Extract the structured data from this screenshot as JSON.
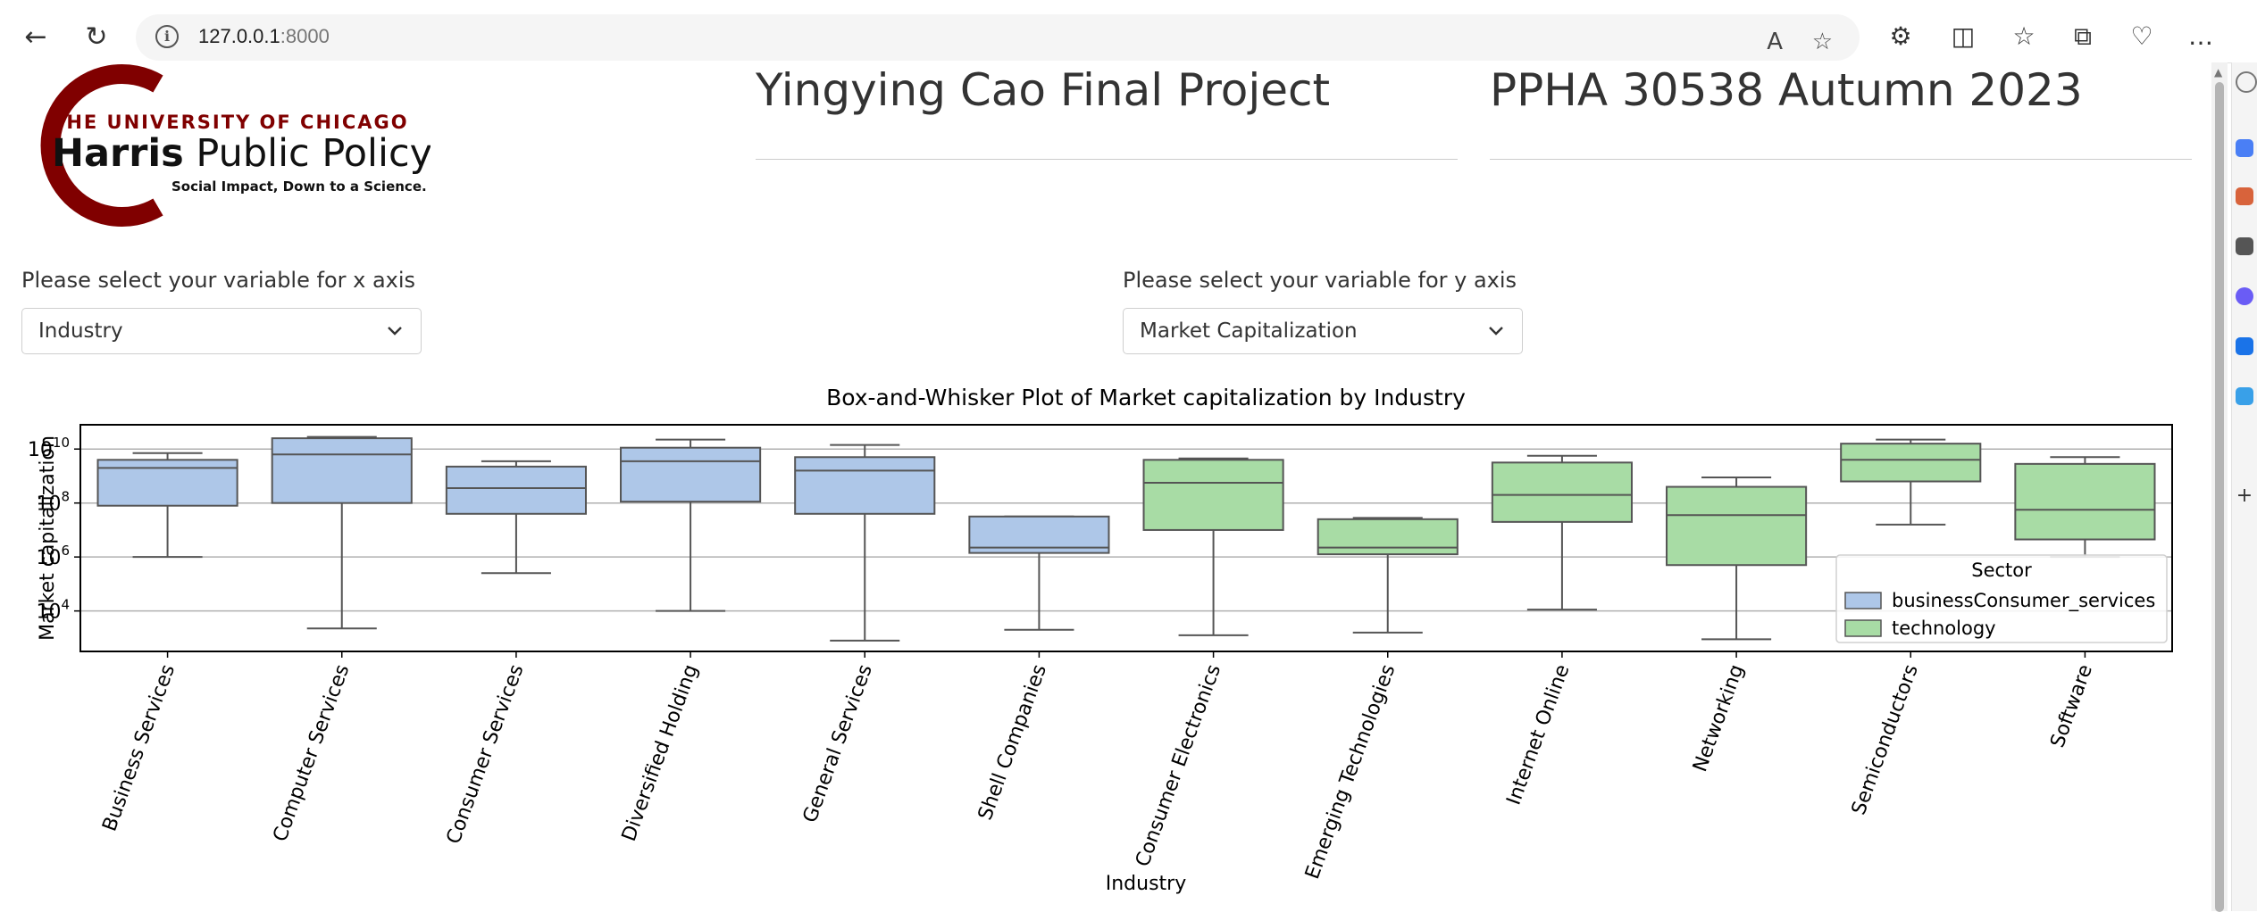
{
  "browser": {
    "url_host": "127.0.0.1",
    "url_port": ":8000"
  },
  "header": {
    "logo": {
      "line1": "THE UNIVERSITY OF CHICAGO",
      "line2_bold": "Harris",
      "line2_rest": " Public Policy",
      "tagline": "Social Impact, Down to a Science."
    },
    "title": "Yingying Cao Final Project",
    "course": "PPHA 30538 Autumn 2023"
  },
  "controls": {
    "x_label": "Please select your variable for x axis",
    "x_selected": "Industry",
    "y_label": "Please select your variable for y axis",
    "y_selected": "Market Capitalization"
  },
  "colors": {
    "business": "#aec7e8",
    "technology": "#a8dca5",
    "box_line": "#555555"
  },
  "chart_data": {
    "type": "box",
    "title": "Box-and-Whisker Plot of Market capitalization by Industry",
    "xlabel": "Industry",
    "ylabel": "Market capitalization",
    "yscale": "log",
    "ytick_exponents": [
      4,
      6,
      8,
      10
    ],
    "ylim_log10": [
      2.5,
      10.9
    ],
    "grid": "horizontal",
    "legend": {
      "title": "Sector",
      "placement": "right",
      "entries": [
        "businessConsumer_services",
        "technology"
      ]
    },
    "categories": [
      "Business Services",
      "Computer Services",
      "Consumer Services",
      "Diversified Holding",
      "General Services",
      "Shell Companies",
      "Consumer Electronics",
      "Emerging Technologies",
      "Internet Online",
      "Networking",
      "Semiconductors",
      "Software"
    ],
    "boxes": [
      {
        "category": "Business Services",
        "sector": "businessConsumer_services",
        "min_log10": 6.0,
        "q1_log10": 7.9,
        "median_log10": 9.3,
        "q3_log10": 9.6,
        "max_log10": 9.85
      },
      {
        "category": "Computer Services",
        "sector": "businessConsumer_services",
        "min_log10": 3.35,
        "q1_log10": 8.0,
        "median_log10": 9.8,
        "q3_log10": 10.4,
        "max_log10": 10.45
      },
      {
        "category": "Consumer Services",
        "sector": "businessConsumer_services",
        "min_log10": 5.4,
        "q1_log10": 7.6,
        "median_log10": 8.55,
        "q3_log10": 9.35,
        "max_log10": 9.55
      },
      {
        "category": "Diversified Holding",
        "sector": "businessConsumer_services",
        "min_log10": 4.0,
        "q1_log10": 8.05,
        "median_log10": 9.55,
        "q3_log10": 10.05,
        "max_log10": 10.35
      },
      {
        "category": "General Services",
        "sector": "businessConsumer_services",
        "min_log10": 2.9,
        "q1_log10": 7.6,
        "median_log10": 9.2,
        "q3_log10": 9.7,
        "max_log10": 10.15
      },
      {
        "category": "Shell Companies",
        "sector": "businessConsumer_services",
        "min_log10": 3.3,
        "q1_log10": 6.15,
        "median_log10": 6.35,
        "q3_log10": 7.5,
        "max_log10": 7.5
      },
      {
        "category": "Consumer Electronics",
        "sector": "technology",
        "min_log10": 3.1,
        "q1_log10": 7.0,
        "median_log10": 8.75,
        "q3_log10": 9.6,
        "max_log10": 9.65
      },
      {
        "category": "Emerging Technologies",
        "sector": "technology",
        "min_log10": 3.2,
        "q1_log10": 6.1,
        "median_log10": 6.35,
        "q3_log10": 7.4,
        "max_log10": 7.45
      },
      {
        "category": "Internet Online",
        "sector": "technology",
        "min_log10": 4.05,
        "q1_log10": 7.3,
        "median_log10": 8.3,
        "q3_log10": 9.5,
        "max_log10": 9.75
      },
      {
        "category": "Networking",
        "sector": "technology",
        "min_log10": 2.95,
        "q1_log10": 5.7,
        "median_log10": 7.55,
        "q3_log10": 8.6,
        "max_log10": 8.95
      },
      {
        "category": "Semiconductors",
        "sector": "technology",
        "min_log10": 7.2,
        "q1_log10": 8.8,
        "median_log10": 9.6,
        "q3_log10": 10.2,
        "max_log10": 10.35
      },
      {
        "category": "Software",
        "sector": "technology",
        "min_log10": 6.0,
        "q1_log10": 6.65,
        "median_log10": 7.75,
        "q3_log10": 9.45,
        "max_log10": 9.7
      }
    ]
  }
}
